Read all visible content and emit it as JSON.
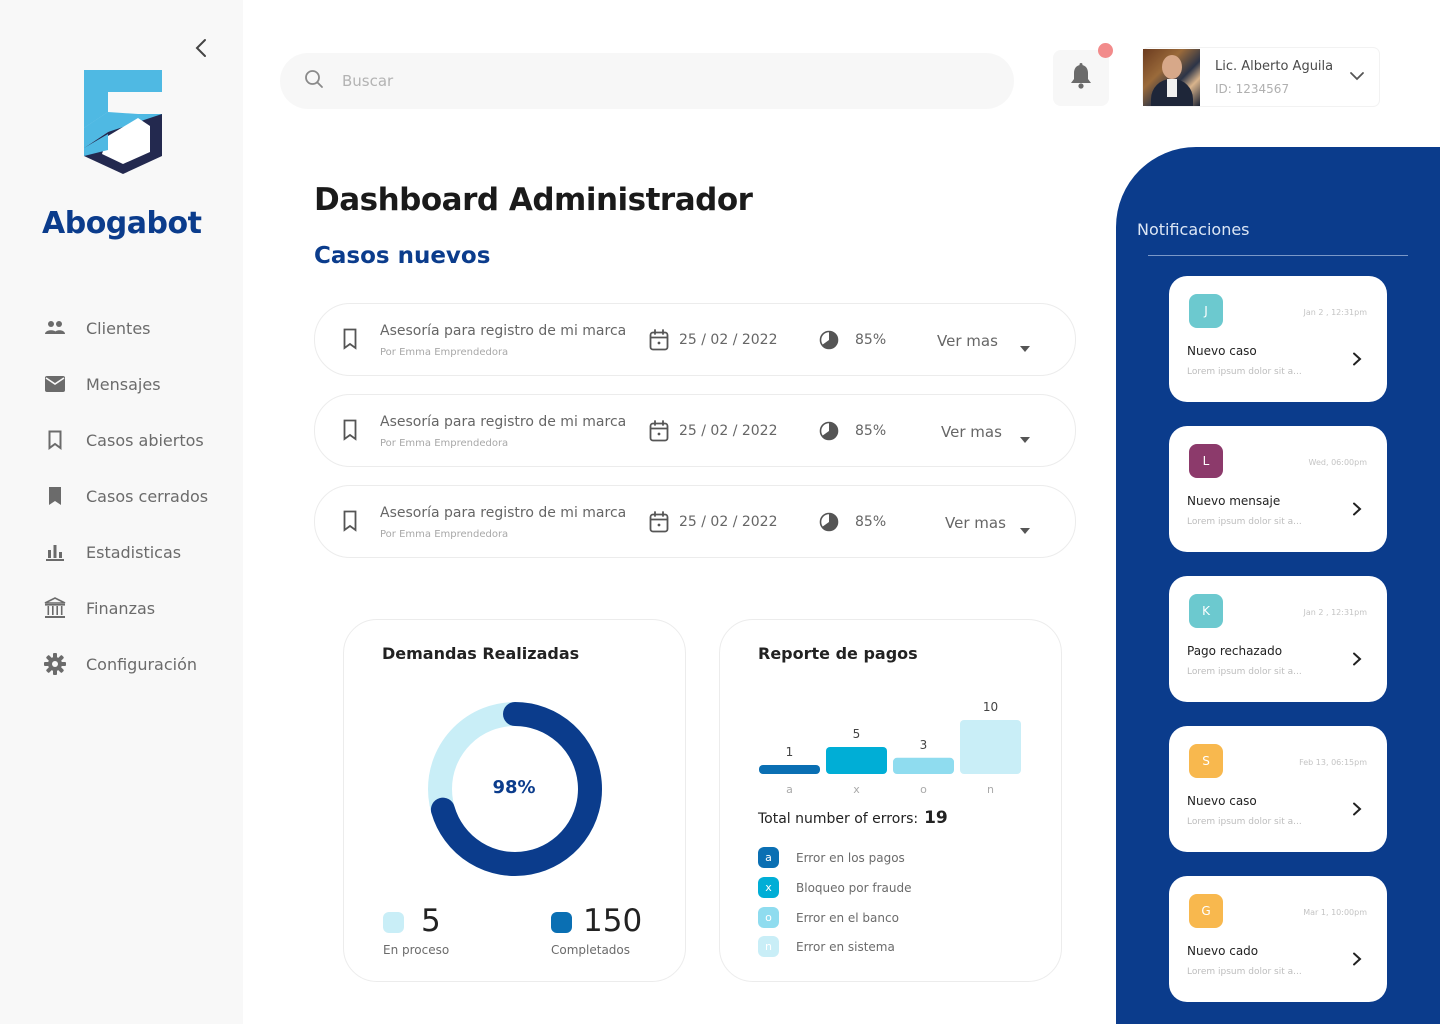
{
  "sidebar": {
    "brand": "Abogabot",
    "items": [
      {
        "label": "Clientes",
        "icon": "people-icon"
      },
      {
        "label": "Mensajes",
        "icon": "mail-icon"
      },
      {
        "label": "Casos abiertos",
        "icon": "bookmark-outline-icon"
      },
      {
        "label": "Casos cerrados",
        "icon": "bookmark-filled-icon"
      },
      {
        "label": "Estadisticas",
        "icon": "bar-chart-icon"
      },
      {
        "label": "Finanzas",
        "icon": "bank-icon"
      },
      {
        "label": "Configuración",
        "icon": "gear-icon"
      }
    ]
  },
  "topbar": {
    "search_placeholder": "Buscar",
    "user": {
      "name": "Lic. Alberto Aguila",
      "id": "ID: 1234567"
    }
  },
  "main": {
    "title": "Dashboard Administrador",
    "section": "Casos nuevos",
    "cases": [
      {
        "title": "Asesoría para registro de mi marca",
        "by": "Por Emma Emprendedora",
        "date": "25 / 02 / 2022",
        "progress": "85%",
        "more": "Ver mas"
      },
      {
        "title": "Asesoría para registro de mi marca",
        "by": "Por Emma Emprendedora",
        "date": "25 / 02 / 2022",
        "progress": "85%",
        "more": "Ver mas"
      },
      {
        "title": "Asesoría para registro de mi marca",
        "by": "Por Emma Emprendedora",
        "date": "25 / 02 / 2022",
        "progress": "85%",
        "more": "Ver mas"
      }
    ]
  },
  "demandas": {
    "title": "Demandas Realizadas",
    "center_label": "98%",
    "fraction": 0.98,
    "stats": [
      {
        "value": "5",
        "label": "En proceso",
        "color": "#c9eef7"
      },
      {
        "value": "150",
        "label": "Completados",
        "color": "#0a6fb3"
      }
    ]
  },
  "pagos": {
    "title": "Reporte de pagos",
    "total_label": "Total number of errors:",
    "total_value": "19",
    "legend": [
      {
        "key": "a",
        "label": "Error en los pagos",
        "color": "#0a6fb3"
      },
      {
        "key": "x",
        "label": "Bloqueo por fraude",
        "color": "#00aed6"
      },
      {
        "key": "o",
        "label": "Error en el banco",
        "color": "#8fdcef"
      },
      {
        "key": "n",
        "label": "Error en sistema",
        "color": "#c9eef7"
      }
    ]
  },
  "chart_data": {
    "type": "bar",
    "categories": [
      "a",
      "x",
      "o",
      "n"
    ],
    "values": [
      1,
      5,
      3,
      10
    ],
    "title": "Reporte de pagos",
    "colors": [
      "#0a6fb3",
      "#00aed6",
      "#8fdcef",
      "#c9eef7"
    ]
  },
  "notifications": {
    "title": "Notificaciones",
    "items": [
      {
        "initial": "J",
        "color": "#6cc9cf",
        "time": "Jan 2 , 12:31pm",
        "title": "Nuevo caso",
        "body": "Lorem ipsum dolor sit a..."
      },
      {
        "initial": "L",
        "color": "#8c3a6b",
        "time": "Wed, 06:00pm",
        "title": "Nuevo mensaje",
        "body": "Lorem ipsum dolor sit a..."
      },
      {
        "initial": "K",
        "color": "#6cc9cf",
        "time": "Jan 2 , 12:31pm",
        "title": "Pago rechazado",
        "body": "Lorem ipsum dolor sit a..."
      },
      {
        "initial": "S",
        "color": "#f8b84e",
        "time": "Feb 13, 06:15pm",
        "title": "Nuevo caso",
        "body": "Lorem ipsum dolor sit a..."
      },
      {
        "initial": "G",
        "color": "#f8b84e",
        "time": "Mar 1, 10:00pm",
        "title": "Nuevo cado",
        "body": "Lorem ipsum dolor sit a..."
      }
    ]
  },
  "colors": {
    "brand": "#0b3c8c",
    "panel": "#0b3c8c",
    "logo_light": "#4fb9e3",
    "logo_dark": "#23294f"
  }
}
